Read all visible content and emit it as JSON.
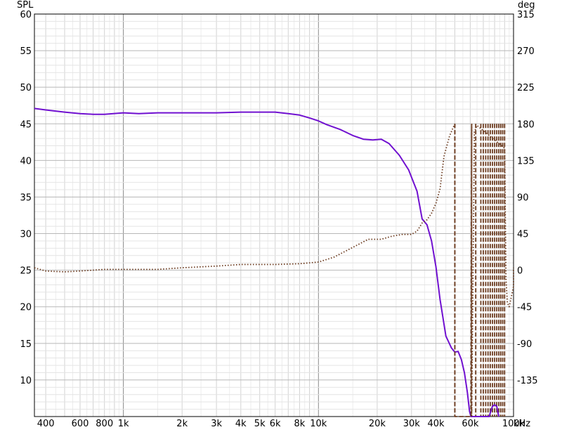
{
  "chart_data": {
    "type": "line",
    "x_scale": "log",
    "xlim": [
      350,
      100000
    ],
    "ylim_left": [
      5,
      60
    ],
    "ylim_right": [
      -180,
      315
    ],
    "left_axis_label": "SPL",
    "right_axis_label": "deg",
    "x_unit": "kHz",
    "grid": true,
    "x_tick_labels": [
      {
        "v": 400,
        "t": "400"
      },
      {
        "v": 600,
        "t": "600"
      },
      {
        "v": 800,
        "t": "800"
      },
      {
        "v": 1000,
        "t": "1k"
      },
      {
        "v": 2000,
        "t": "2k"
      },
      {
        "v": 3000,
        "t": "3k"
      },
      {
        "v": 4000,
        "t": "4k"
      },
      {
        "v": 5000,
        "t": "5k"
      },
      {
        "v": 6000,
        "t": "6k"
      },
      {
        "v": 8000,
        "t": "8k"
      },
      {
        "v": 10000,
        "t": "10k"
      },
      {
        "v": 20000,
        "t": "20k"
      },
      {
        "v": 30000,
        "t": "30k"
      },
      {
        "v": 40000,
        "t": "40k"
      },
      {
        "v": 60000,
        "t": "60k"
      },
      {
        "v": 100000,
        "t": "100k"
      }
    ],
    "y_left_ticks": [
      10,
      15,
      20,
      25,
      30,
      35,
      40,
      45,
      50,
      55,
      60
    ],
    "y_right_ticks": [
      -135,
      -90,
      -45,
      0,
      45,
      90,
      135,
      180,
      225,
      270,
      315
    ],
    "series": [
      {
        "axis": "left",
        "color": "#7010d0",
        "style": "solid",
        "x": [
          350,
          400,
          500,
          600,
          700,
          800,
          1000,
          1200,
          1500,
          2000,
          3000,
          4000,
          4500,
          5000,
          5500,
          6000,
          7000,
          8000,
          9000,
          10000,
          11000,
          13000,
          15000,
          17000,
          19000,
          21000,
          23000,
          26000,
          29000,
          32000,
          34000,
          36000,
          38000,
          40000,
          42000,
          45000,
          48000,
          50000,
          52000,
          54000,
          56000,
          58000,
          59500,
          60500,
          75000,
          78000,
          80000,
          82000,
          84000
        ],
        "y": [
          47.1,
          46.9,
          46.6,
          46.4,
          46.3,
          46.3,
          46.5,
          46.4,
          46.5,
          46.5,
          46.5,
          46.6,
          46.6,
          46.6,
          46.6,
          46.6,
          46.4,
          46.2,
          45.8,
          45.4,
          44.9,
          44.2,
          43.4,
          42.9,
          42.8,
          42.9,
          42.3,
          40.7,
          38.7,
          35.8,
          32.0,
          31.2,
          29.0,
          25.5,
          21.0,
          16.0,
          14.4,
          13.8,
          13.9,
          12.8,
          11.0,
          8.3,
          5.7,
          5.0,
          5.0,
          6.4,
          6.6,
          6.4,
          5.0
        ]
      },
      {
        "axis": "right",
        "color": "#6b3a1e",
        "style": "dotted",
        "x": [
          350,
          400,
          500,
          600,
          800,
          1000,
          1500,
          2000,
          3000,
          4000,
          5000,
          6000,
          8000,
          10000,
          12000,
          15000,
          18000,
          21000,
          24000,
          27000,
          30000,
          32000,
          34000,
          36000,
          38000,
          40000,
          42000,
          44000,
          47000,
          50000
        ],
        "y": [
          3,
          -1,
          -2,
          -1,
          1,
          1,
          1,
          3,
          5,
          7,
          7,
          7,
          8,
          10,
          16,
          28,
          38,
          38,
          42,
          44,
          44,
          48,
          58,
          62,
          70,
          82,
          100,
          140,
          165,
          180
        ]
      },
      {
        "axis": "right",
        "color": "#6b3a1e",
        "style": "dotted",
        "x": [
          61000,
          63000,
          65000,
          90000,
          91500,
          93000,
          95000,
          97000,
          100000,
          103000,
          107000,
          110000
        ],
        "y": [
          -180,
          170,
          178,
          150,
          -10,
          -40,
          -45,
          -35,
          -20,
          -10,
          0,
          3
        ]
      },
      {
        "axis": "right",
        "color": "#6b3a1e",
        "style": "dashed",
        "x": [
          50000,
          50000,
          54000,
          56000,
          58000,
          60000,
          60500,
          61000
        ],
        "y": [
          180,
          -180,
          -180,
          -180,
          -180,
          -180,
          -180,
          180
        ]
      }
    ],
    "phase_wrap_dashes_x": [
      50000,
      61000,
      64000,
      68000,
      70000,
      72000,
      74000,
      76000,
      78000,
      80000,
      82000,
      84000,
      86000,
      88000,
      90000
    ]
  }
}
